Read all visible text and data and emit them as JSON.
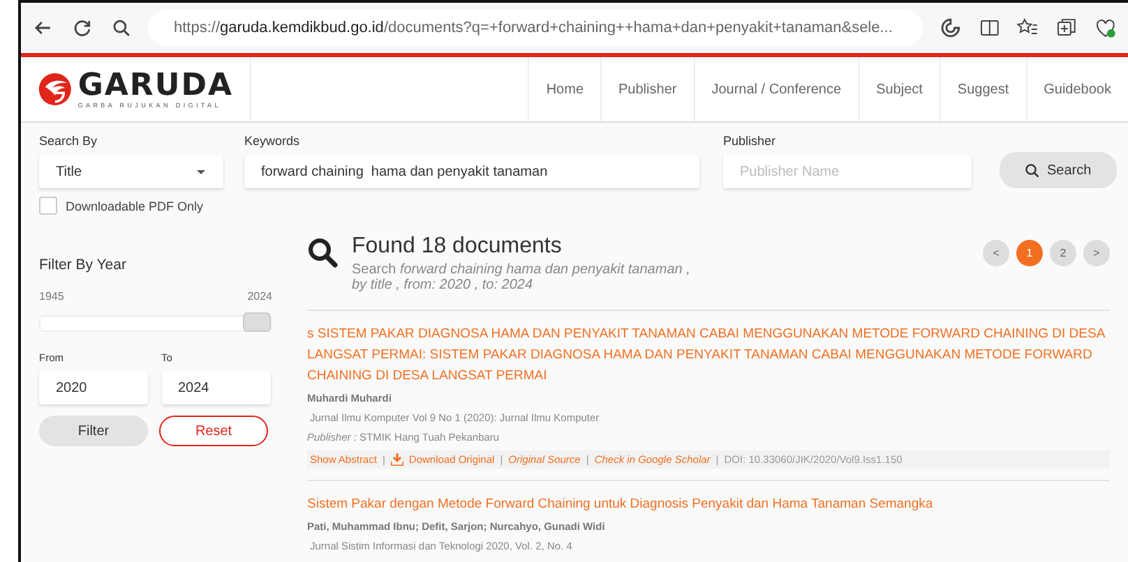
{
  "browser": {
    "url_prefix": "https://",
    "url_host": "garuda.kemdikbud.go.id",
    "url_path": "/documents?q=+forward+chaining++hama+dan+penyakit+tanaman&sele..."
  },
  "header": {
    "logo_text": "GARUDA",
    "logo_tagline": "GARBA RUJUKAN DIGITAL",
    "nav": [
      "Home",
      "Publisher",
      "Journal / Conference",
      "Subject",
      "Suggest",
      "Guidebook"
    ]
  },
  "search": {
    "search_by_label": "Search By",
    "search_by_value": "Title",
    "keywords_label": "Keywords",
    "keywords_value": "forward chaining  hama dan penyakit tanaman",
    "publisher_label": "Publisher",
    "publisher_placeholder": "Publisher Name",
    "search_button": "Search",
    "pdf_only": {
      "label": "Downloadable PDF Only",
      "checked": false
    }
  },
  "filter": {
    "title": "Filter By Year",
    "min_label": "1945",
    "max_label": "2024",
    "level": 1,
    "from_label": "From",
    "from_value": "2020",
    "to_label": "To",
    "to_value": "2024",
    "filter_button": "Filter",
    "reset_button": "Reset"
  },
  "results": {
    "heading": "Found 18 documents",
    "summary": "Search  *forward chaining  hama dan penyakit tanaman , by title , from: 2020 , to: 2024*",
    "pages": [
      {
        "label": "<",
        "selected": false
      },
      {
        "label": "1",
        "selected": true
      },
      {
        "label": "2",
        "selected": false
      },
      {
        "label": ">",
        "selected": false
      }
    ],
    "documents": [
      {
        "title": "s SISTEM PAKAR DIAGNOSA HAMA DAN PENYAKIT TANAMAN CABAI MENGGUNAKAN METODE FORWARD CHAINING DI DESA LANGSAT PERMAI: SISTEM PAKAR DIAGNOSA HAMA DAN PENYAKIT TANAMAN CABAI MENGGUNAKAN METODE FORWARD CHAINING DI DESA LANGSAT PERMAI",
        "authors": "Muhardi Muhardi",
        "journal": "Jurnal Ilmu Komputer Vol 9 No 1 (2020): Jurnal Ilmu Komputer",
        "publisher_label": "Publisher :",
        "publisher": "STMIK Hang Tuah Pekanbaru",
        "links": [
          {
            "kind": "plain",
            "text": "Show Abstract"
          },
          {
            "kind": "download",
            "text": "Download Original"
          },
          {
            "kind": "italic",
            "text": "Original Source"
          },
          {
            "kind": "italic",
            "text": "Check in Google Scholar"
          },
          {
            "kind": "doi",
            "text": "DOI: 10.33060/JIK/2020/Vol9.Iss1.150"
          }
        ]
      },
      {
        "title": "Sistem Pakar dengan Metode Forward Chaining untuk Diagnosis Penyakit dan Hama Tanaman Semangka",
        "authors": "Pati, Muhammad Ibnu; Defit, Sarjon; Nurcahyo, Gunadi Widi",
        "journal": "Jurnal Sistim Informasi dan Teknologi 2020, Vol. 2, No. 4"
      }
    ],
    "separator": "|"
  }
}
